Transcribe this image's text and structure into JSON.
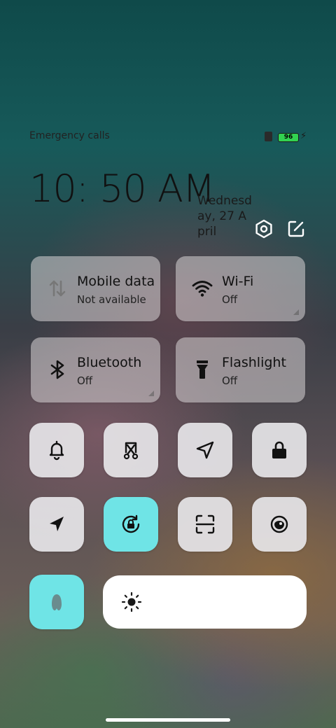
{
  "status_bar": {
    "left_text": "Emergency calls only",
    "battery_level": "96"
  },
  "header": {
    "time": "10: 50 AM",
    "date": "Wednesday, 27 April"
  },
  "tiles": [
    {
      "title": "Mobile data",
      "subtitle": "Not available",
      "icon": "mobile-data-icon"
    },
    {
      "title": "Wi-Fi",
      "subtitle": "Off",
      "icon": "wifi-icon"
    },
    {
      "title": "Bluetooth",
      "subtitle": "Off",
      "icon": "bluetooth-icon"
    },
    {
      "title": "Flashlight",
      "subtitle": "Off",
      "icon": "flashlight-icon"
    }
  ],
  "toggles_row1": [
    "mute-icon",
    "screenshot-icon",
    "location-outline-icon",
    "lock-icon"
  ],
  "toggles_row2": [
    "location-icon",
    "rotation-lock-icon",
    "scanner-icon",
    "eye-comfort-icon"
  ],
  "colors": {
    "active_toggle": "#6fe4e6",
    "battery_fill": "#32d250"
  },
  "brightness": {
    "icon": "brightness-icon"
  }
}
